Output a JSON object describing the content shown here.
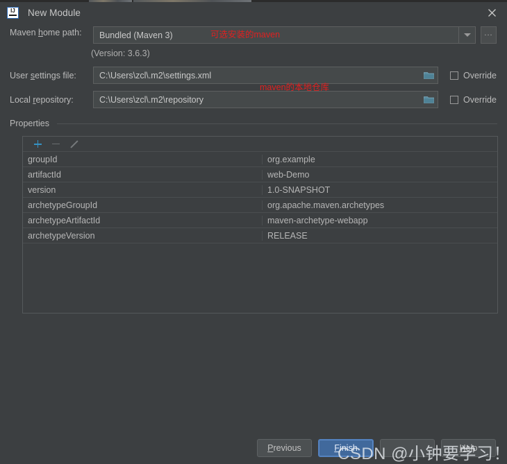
{
  "window": {
    "title": "New Module",
    "app_icon": "intellij-idea-icon",
    "close_icon": "close-icon"
  },
  "form": {
    "maven_home": {
      "label_prefix": "Maven ",
      "label_mnemonic": "h",
      "label_suffix": "ome path:",
      "label_full": "Maven home path:",
      "value": "Bundled (Maven 3)",
      "dropdown_icon": "chevron-down-icon",
      "browse_label": "...",
      "version_note": "(Version: 3.6.3)"
    },
    "user_settings": {
      "label_prefix": "User ",
      "label_mnemonic": "s",
      "label_suffix": "ettings file:",
      "label_full": "User settings file:",
      "value": "C:\\Users\\zcl\\.m2\\settings.xml",
      "browse_icon": "folder-icon",
      "override_label": "Override",
      "override_checked": false
    },
    "local_repository": {
      "label_prefix": "Local ",
      "label_mnemonic": "r",
      "label_suffix": "epository:",
      "label_full": "Local repository:",
      "value": "C:\\Users\\zcl\\.m2\\repository",
      "browse_icon": "folder-icon",
      "override_label": "Override",
      "override_checked": false
    }
  },
  "properties": {
    "group_label": "Properties",
    "toolbar": {
      "add_icon": "plus-icon",
      "remove_icon": "minus-icon",
      "edit_icon": "pencil-icon"
    },
    "rows": [
      {
        "key": "groupId",
        "value": "org.example"
      },
      {
        "key": "artifactId",
        "value": "web-Demo"
      },
      {
        "key": "version",
        "value": "1.0-SNAPSHOT"
      },
      {
        "key": "archetypeGroupId",
        "value": "org.apache.maven.archetypes"
      },
      {
        "key": "archetypeArtifactId",
        "value": "maven-archetype-webapp"
      },
      {
        "key": "archetypeVersion",
        "value": "RELEASE"
      }
    ]
  },
  "annotations": [
    {
      "text": "可选安装的maven",
      "name": "annotation-maven-home"
    },
    {
      "text": "maven的本地仓库",
      "name": "annotation-local-repo"
    }
  ],
  "footer": {
    "previous": {
      "prefix": "",
      "mnemonic": "P",
      "suffix": "revious",
      "full": "Previous"
    },
    "finish": {
      "prefix": "",
      "mnemonic": "F",
      "suffix": "inish",
      "full": "Finish"
    },
    "cancel": {
      "prefix": "",
      "mnemonic": "C",
      "suffix": "ancel",
      "full": "Cancel"
    },
    "help": {
      "prefix": "",
      "mnemonic": "H",
      "suffix": "elp",
      "full": "Help"
    }
  },
  "watermark": {
    "text": "CSDN @小钟要学习！！"
  },
  "colors": {
    "dialog_bg": "#3c3f41",
    "field_bg": "#45494a",
    "border": "#5e6060",
    "text": "#bbbbbb",
    "accent": "#3592c4",
    "primary_button": "#41699c",
    "annotation": "#e02020"
  }
}
